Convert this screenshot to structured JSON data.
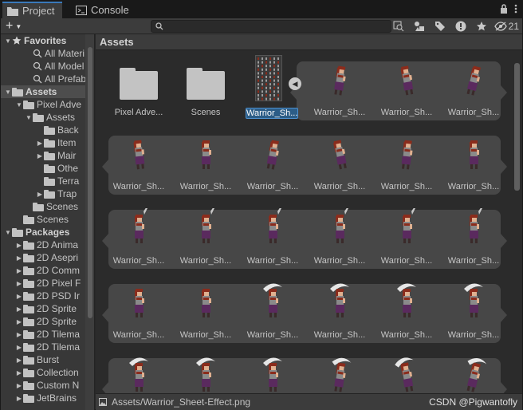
{
  "tabs": [
    {
      "label": "Project",
      "icon": "folder-icon",
      "active": true
    },
    {
      "label": "Console",
      "icon": "console-icon",
      "active": false
    }
  ],
  "toolbar": {
    "add_label": "+",
    "search_placeholder": "",
    "hidden_count": "21"
  },
  "tree": [
    {
      "label": "Favorites",
      "level": 0,
      "header": true,
      "icon": "star-icon",
      "arrow": "▼"
    },
    {
      "label": "All Materi",
      "level": 2,
      "icon": "search-icon"
    },
    {
      "label": "All Model",
      "level": 2,
      "icon": "search-icon"
    },
    {
      "label": "All Prefab",
      "level": 2,
      "icon": "search-icon"
    },
    {
      "label": "Assets",
      "level": 0,
      "header": true,
      "icon": "folder-icon",
      "arrow": "▼",
      "selected": true
    },
    {
      "label": "Pixel Adve",
      "level": 1,
      "icon": "folder-icon",
      "arrow": "▼"
    },
    {
      "label": "Assets",
      "level": 2,
      "icon": "folder-icon",
      "arrow": "▼"
    },
    {
      "label": "Back",
      "level": 3,
      "icon": "folder-icon"
    },
    {
      "label": "Item",
      "level": 3,
      "icon": "folder-icon",
      "arrow": "▶"
    },
    {
      "label": "Mair",
      "level": 3,
      "icon": "folder-icon",
      "arrow": "▶"
    },
    {
      "label": "Othe",
      "level": 3,
      "icon": "folder-icon"
    },
    {
      "label": "Terra",
      "level": 3,
      "icon": "folder-icon"
    },
    {
      "label": "Trap",
      "level": 3,
      "icon": "folder-icon",
      "arrow": "▶"
    },
    {
      "label": "Scenes",
      "level": 2,
      "icon": "folder-icon"
    },
    {
      "label": "Scenes",
      "level": 1,
      "icon": "folder-icon"
    },
    {
      "label": "Packages",
      "level": 0,
      "header": true,
      "icon": "folder-icon",
      "arrow": "▼"
    },
    {
      "label": "2D Anima",
      "level": 1,
      "icon": "folder-icon",
      "arrow": "▶"
    },
    {
      "label": "2D Asepri",
      "level": 1,
      "icon": "folder-icon",
      "arrow": "▶"
    },
    {
      "label": "2D Comm",
      "level": 1,
      "icon": "folder-icon",
      "arrow": "▶"
    },
    {
      "label": "2D Pixel F",
      "level": 1,
      "icon": "folder-icon",
      "arrow": "▶"
    },
    {
      "label": "2D PSD Ir",
      "level": 1,
      "icon": "folder-icon",
      "arrow": "▶"
    },
    {
      "label": "2D Sprite",
      "level": 1,
      "icon": "folder-icon",
      "arrow": "▶"
    },
    {
      "label": "2D Sprite",
      "level": 1,
      "icon": "folder-icon",
      "arrow": "▶"
    },
    {
      "label": "2D Tilema",
      "level": 1,
      "icon": "folder-icon",
      "arrow": "▶"
    },
    {
      "label": "2D Tilema",
      "level": 1,
      "icon": "folder-icon",
      "arrow": "▶"
    },
    {
      "label": "Burst",
      "level": 1,
      "icon": "folder-icon",
      "arrow": "▶"
    },
    {
      "label": "Collection",
      "level": 1,
      "icon": "folder-icon",
      "arrow": "▶"
    },
    {
      "label": "Custom N",
      "level": 1,
      "icon": "folder-icon",
      "arrow": "▶"
    },
    {
      "label": "JetBrains",
      "level": 1,
      "icon": "folder-icon",
      "arrow": "▶"
    }
  ],
  "breadcrumb": "Assets",
  "grid": {
    "row1": [
      {
        "label": "Pixel Adve...",
        "kind": "folder"
      },
      {
        "label": "Scenes",
        "kind": "folder"
      },
      {
        "label": "Warrior_Sh...",
        "kind": "sheet",
        "selected": true
      },
      {
        "label": "Warrior_Sh...",
        "kind": "sprite"
      },
      {
        "label": "Warrior_Sh...",
        "kind": "sprite"
      },
      {
        "label": "Warrior_Sh...",
        "kind": "sprite"
      }
    ],
    "row2": [
      "Warrior_Sh...",
      "Warrior_Sh...",
      "Warrior_Sh...",
      "Warrior_Sh...",
      "Warrior_Sh...",
      "Warrior_Sh..."
    ],
    "row3": [
      "Warrior_Sh...",
      "Warrior_Sh...",
      "Warrior_Sh...",
      "Warrior_Sh...",
      "Warrior_Sh...",
      "Warrior_Sh..."
    ],
    "row4": [
      "Warrior_Sh...",
      "Warrior_Sh...",
      "Warrior_Sh...",
      "Warrior_Sh...",
      "Warrior_Sh...",
      "Warrior_Sh..."
    ],
    "row5": [
      "",
      "",
      "",
      "",
      "",
      ""
    ]
  },
  "status": {
    "path": "Assets/Warrior_Sheet-Effect.png",
    "watermark": "CSDN @Pigwantofly"
  },
  "colors": {
    "selection": "#2c5d87",
    "tab_accent": "#3a79bb",
    "hair": "#8b2c1c",
    "cloth": "#5a2a5e",
    "skin": "#e0b090"
  }
}
